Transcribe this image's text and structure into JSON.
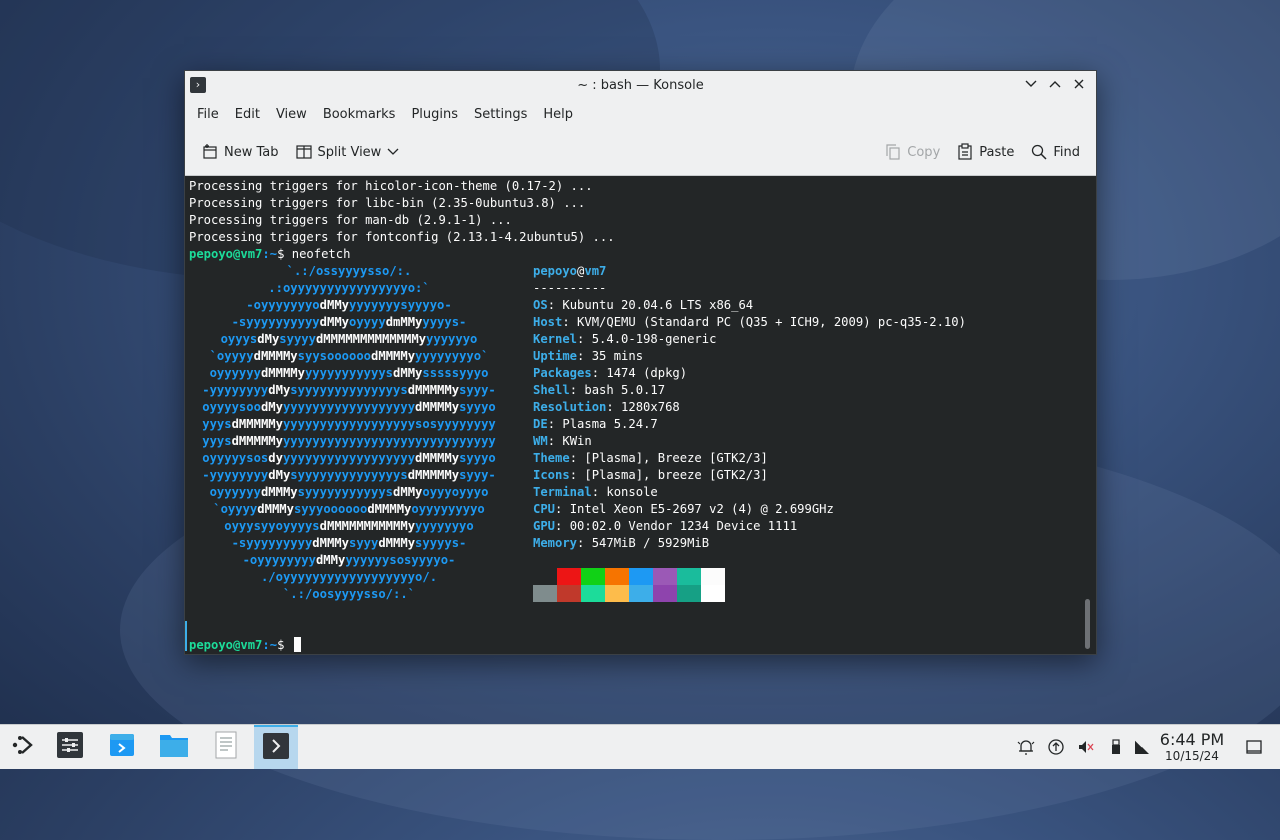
{
  "window": {
    "title": "~ : bash — Konsole",
    "menu": [
      "File",
      "Edit",
      "View",
      "Bookmarks",
      "Plugins",
      "Settings",
      "Help"
    ],
    "toolbar": {
      "new_tab": "New Tab",
      "split_view": "Split View",
      "copy": "Copy",
      "paste": "Paste",
      "find": "Find"
    }
  },
  "terminal": {
    "output_lines": [
      "Processing triggers for hicolor-icon-theme (0.17-2) ...",
      "Processing triggers for libc-bin (2.35-0ubuntu3.8) ...",
      "Processing triggers for man-db (2.9.1-1) ...",
      "Processing triggers for fontconfig (2.13.1-4.2ubuntu5) ..."
    ],
    "prompt_user": "pepoyo@vm7",
    "prompt_path": ":~",
    "prompt_symbol": "$",
    "command": "neofetch",
    "logo_lines": [
      [
        [
          "c",
          "`.:/ossyyyysso/:."
        ]
      ],
      [
        [
          "c",
          ".:oyyyyyyyyyyyyyyyyo:`"
        ]
      ],
      [
        [
          "c",
          "-oyyyyyyyo"
        ],
        [
          "w",
          "dMMy"
        ],
        [
          "c",
          "yyyyyyysyyyyo-"
        ]
      ],
      [
        [
          "c",
          "-syyyyyyyyyy"
        ],
        [
          "w",
          "dMMy"
        ],
        [
          "c",
          "oyyyy"
        ],
        [
          "w",
          "dmMMy"
        ],
        [
          "c",
          "yyyys-"
        ]
      ],
      [
        [
          "c",
          "oyyys"
        ],
        [
          "w",
          "dMy"
        ],
        [
          "c",
          "syyyy"
        ],
        [
          "w",
          "dMMMMMMMMMMMMMy"
        ],
        [
          "c",
          "yyyyyyo"
        ]
      ],
      [
        [
          "c",
          "`oyyyy"
        ],
        [
          "w",
          "dMMMMy"
        ],
        [
          "c",
          "syysoooooo"
        ],
        [
          "w",
          "dMMMMy"
        ],
        [
          "c",
          "yyyyyyyyo`"
        ]
      ],
      [
        [
          "c",
          "oyyyyyy"
        ],
        [
          "w",
          "dMMMMy"
        ],
        [
          "c",
          "yyyyyyyyyyys"
        ],
        [
          "w",
          "dMMy"
        ],
        [
          "c",
          "sssssyyyo"
        ]
      ],
      [
        [
          "c",
          "-yyyyyyyy"
        ],
        [
          "w",
          "dMy"
        ],
        [
          "c",
          "syyyyyyyyyyyyyys"
        ],
        [
          "w",
          "dMMMMMy"
        ],
        [
          "c",
          "syyy-"
        ]
      ],
      [
        [
          "c",
          "oyyyysoo"
        ],
        [
          "w",
          "dMy"
        ],
        [
          "c",
          "yyyyyyyyyyyyyyyyyy"
        ],
        [
          "w",
          "dMMMMy"
        ],
        [
          "c",
          "syyyo"
        ]
      ],
      [
        [
          "c",
          "yyys"
        ],
        [
          "w",
          "dMMMMMy"
        ],
        [
          "c",
          "yyyyyyyyyyyyyyyyyysosyyyyyyyy"
        ]
      ],
      [
        [
          "c",
          "yyys"
        ],
        [
          "w",
          "dMMMMMy"
        ],
        [
          "c",
          "yyyyyyyyyyyyyyyyyyyyyyyyyyyyy"
        ]
      ],
      [
        [
          "c",
          "oyyyyysos"
        ],
        [
          "w",
          "dy"
        ],
        [
          "c",
          "yyyyyyyyyyyyyyyyyy"
        ],
        [
          "w",
          "dMMMMy"
        ],
        [
          "c",
          "syyyo"
        ]
      ],
      [
        [
          "c",
          "-yyyyyyyy"
        ],
        [
          "w",
          "dMy"
        ],
        [
          "c",
          "syyyyyyyyyyyyyys"
        ],
        [
          "w",
          "dMMMMMy"
        ],
        [
          "c",
          "syyy-"
        ]
      ],
      [
        [
          "c",
          "oyyyyyy"
        ],
        [
          "w",
          "dMMMy"
        ],
        [
          "c",
          "syyyyyyyyyyys"
        ],
        [
          "w",
          "dMMy"
        ],
        [
          "c",
          "oyyyoyyyo"
        ]
      ],
      [
        [
          "c",
          "`oyyyy"
        ],
        [
          "w",
          "dMMMy"
        ],
        [
          "c",
          "syyyoooooo"
        ],
        [
          "w",
          "dMMMMy"
        ],
        [
          "c",
          "oyyyyyyyyo"
        ]
      ],
      [
        [
          "c",
          "oyyysyyoyyyys"
        ],
        [
          "w",
          "dMMMMMMMMMMMy"
        ],
        [
          "c",
          "yyyyyyyo"
        ]
      ],
      [
        [
          "c",
          "-syyyyyyyyy"
        ],
        [
          "w",
          "dMMMy"
        ],
        [
          "c",
          "syyy"
        ],
        [
          "w",
          "dMMMy"
        ],
        [
          "c",
          "syyyys-"
        ]
      ],
      [
        [
          "c",
          "-oyyyyyyyy"
        ],
        [
          "w",
          "dMMy"
        ],
        [
          "c",
          "yyyyyysosyyyyo-"
        ]
      ],
      [
        [
          "c",
          "./oyyyyyyyyyyyyyyyyyyo/."
        ]
      ],
      [
        [
          "c",
          "`.:/oosyyyysso/:.`"
        ]
      ]
    ],
    "info_title_user": "pepoyo",
    "info_title_at": "@",
    "info_title_host": "vm7",
    "info_separator": "----------",
    "info": [
      {
        "key": "OS",
        "value": ": Kubuntu 20.04.6 LTS x86_64"
      },
      {
        "key": "Host",
        "value": ": KVM/QEMU (Standard PC (Q35 + ICH9, 2009) pc-q35-2.10)"
      },
      {
        "key": "Kernel",
        "value": ": 5.4.0-198-generic"
      },
      {
        "key": "Uptime",
        "value": ": 35 mins"
      },
      {
        "key": "Packages",
        "value": ": 1474 (dpkg)"
      },
      {
        "key": "Shell",
        "value": ": bash 5.0.17"
      },
      {
        "key": "Resolution",
        "value": ": 1280x768"
      },
      {
        "key": "DE",
        "value": ": Plasma 5.24.7"
      },
      {
        "key": "WM",
        "value": ": KWin"
      },
      {
        "key": "Theme",
        "value": ": [Plasma], Breeze [GTK2/3]"
      },
      {
        "key": "Icons",
        "value": ": [Plasma], breeze [GTK2/3]"
      },
      {
        "key": "Terminal",
        "value": ": konsole"
      },
      {
        "key": "CPU",
        "value": ": Intel Xeon E5-2697 v2 (4) @ 2.699GHz"
      },
      {
        "key": "GPU",
        "value": ": 00:02.0 Vendor 1234 Device 1111"
      },
      {
        "key": "Memory",
        "value": ": 547MiB / 5929MiB"
      }
    ],
    "color_blocks_top": [
      "#232627",
      "#ed1515",
      "#11d116",
      "#f67400",
      "#1d99f3",
      "#9b59b6",
      "#1abc9c",
      "#fcfcfc"
    ],
    "color_blocks_bottom": [
      "#7f8c8d",
      "#c0392b",
      "#1cdc9a",
      "#fdbc4b",
      "#3daee9",
      "#8e44ad",
      "#16a085",
      "#ffffff"
    ]
  },
  "taskbar": {
    "clock_time": "6:44 PM",
    "clock_date": "10/15/24"
  },
  "colors": {
    "accent": "#3daee9",
    "terminal_bg": "#232627",
    "prompt_green": "#1cdc9a",
    "prompt_blue": "#1d99f3"
  }
}
